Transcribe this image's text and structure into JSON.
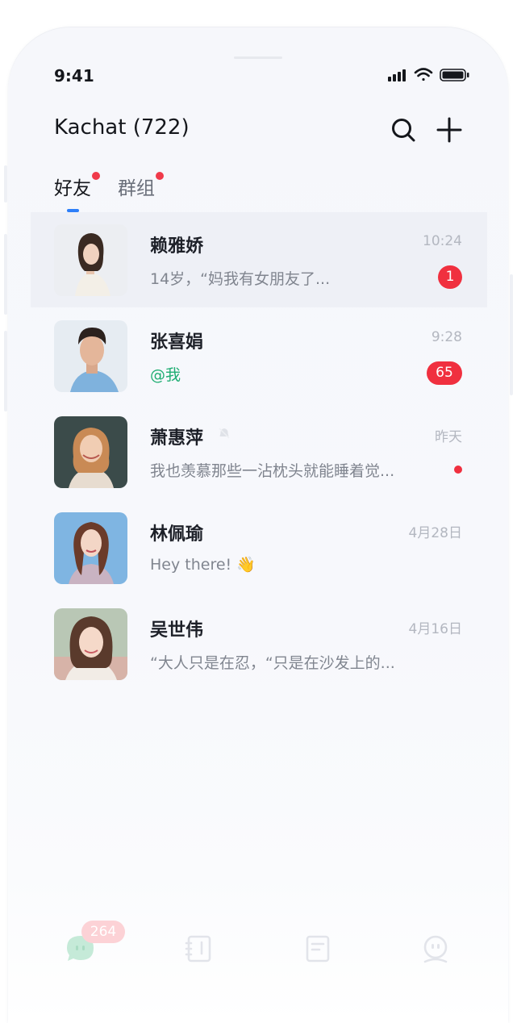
{
  "status_bar": {
    "time": "9:41"
  },
  "header": {
    "title": "Kachat (722)"
  },
  "tabs": [
    {
      "label": "好友",
      "active": true,
      "has_dot": true
    },
    {
      "label": "群组",
      "active": false,
      "has_dot": true
    }
  ],
  "chats": [
    {
      "name": "赖雅娇",
      "preview": "14岁，“妈我有女朋友了...",
      "time": "10:24",
      "badge": "1"
    },
    {
      "name": "张喜娟",
      "preview": "@我",
      "time": "9:28",
      "badge": "65"
    },
    {
      "name": "萧惠萍",
      "preview": "我也羡慕那些一沾枕头就能睡着觉...",
      "time": "昨天",
      "unread_dot": true,
      "muted": true
    },
    {
      "name": "林佩瑜",
      "preview": "Hey there! 👋",
      "time": "4月28日"
    },
    {
      "name": "吴世伟",
      "preview": "“大人只是在忍，“只是在沙发上的...",
      "time": "4月16日"
    }
  ],
  "bottom_nav": {
    "messages_badge": "264",
    "items": [
      {
        "icon": "chat-bubble-icon",
        "active": true
      },
      {
        "icon": "contacts-book-icon"
      },
      {
        "icon": "document-icon"
      },
      {
        "icon": "profile-face-icon"
      }
    ]
  },
  "colors": {
    "accent": "#2d7ff9",
    "badge": "#f03a4a",
    "mention": "#1fae73",
    "nav_active": "#1fae73"
  }
}
